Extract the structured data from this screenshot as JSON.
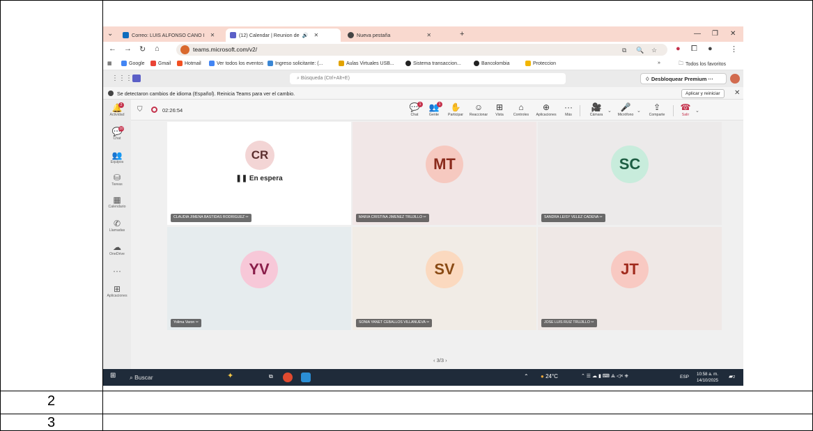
{
  "row_numbers": [
    "2",
    "3"
  ],
  "browser": {
    "tabs": [
      {
        "title": "Correo: LUIS ALFONSO CANO I",
        "fav_color": "#0f6cbd"
      },
      {
        "title": "(12) Calendar | Reunion de",
        "fav_color": "#5b5fc7",
        "audio": "🔊"
      },
      {
        "title": "Nueva pestaña",
        "fav_color": "#444444"
      }
    ],
    "new_tab": "+",
    "url": "teams.microsoft.com/v2/",
    "bookmarks": [
      {
        "label": "Google",
        "color": "#4285f4"
      },
      {
        "label": "Gmail",
        "color": "#ea4335"
      },
      {
        "label": "Hotmail",
        "color": "#f25022"
      },
      {
        "label": "Ver todos los eventos",
        "color": "#4285f4"
      },
      {
        "label": "Ingreso solicitante: (...",
        "color": "#3a86d4"
      },
      {
        "label": "Aulas Virtuales USB...",
        "color": "#e2a300"
      },
      {
        "label": "Sistema transaccion...",
        "color": "#222222"
      },
      {
        "label": "Bancolombia",
        "color": "#222222"
      },
      {
        "label": "Proteccion",
        "color": "#f2b600"
      }
    ],
    "all_favorites": "Todos los favoritos",
    "more_bookmarks": "»"
  },
  "teams": {
    "search_placeholder": "Búsqueda (Ctrl+Alt+E)",
    "premium_label": "Desbloquear Premium",
    "premium_more": "···",
    "notice_text": "Se detectaron cambios de idioma (Español). Reinicia Teams para ver el cambio.",
    "notice_button": "Aplicar y reiniciar",
    "rail": [
      {
        "label": "Actividad",
        "icon": "bell-icon",
        "glyph": "🔔",
        "badge": "2"
      },
      {
        "label": "Chat",
        "icon": "chat-icon",
        "glyph": "💬",
        "badge": "10"
      },
      {
        "label": "Equipos",
        "icon": "teams-icon",
        "glyph": "👥",
        "badge": ""
      },
      {
        "label": "Tareas",
        "icon": "tasks-icon",
        "glyph": "⛁",
        "badge": ""
      },
      {
        "label": "Calendario",
        "icon": "calendar-icon",
        "glyph": "▦",
        "badge": ""
      },
      {
        "label": "Llamadas",
        "icon": "phone-icon",
        "glyph": "✆",
        "badge": ""
      },
      {
        "label": "OneDrive",
        "icon": "cloud-icon",
        "glyph": "☁",
        "badge": ""
      },
      {
        "label": "",
        "icon": "more-icon",
        "glyph": "···",
        "badge": ""
      },
      {
        "label": "Aplicaciones",
        "icon": "apps-icon",
        "glyph": "⊞",
        "badge": ""
      }
    ],
    "meeting_timer": "02:26:54",
    "controls": [
      {
        "label": "Chat",
        "glyph": "💬",
        "badge": "1"
      },
      {
        "label": "Gente",
        "glyph": "👥",
        "badge": "1"
      },
      {
        "label": "Participar",
        "glyph": "✋",
        "badge": ""
      },
      {
        "label": "Reaccionar",
        "glyph": "☺",
        "badge": ""
      },
      {
        "label": "Vista",
        "glyph": "⊞",
        "badge": ""
      },
      {
        "label": "Controles",
        "glyph": "⌂",
        "badge": ""
      },
      {
        "label": "Aplicaciones",
        "glyph": "⊕",
        "badge": ""
      },
      {
        "label": "Más",
        "glyph": "···",
        "badge": ""
      },
      {
        "label": "Cámara",
        "glyph": "🎥",
        "badge": ""
      },
      {
        "label": "Micrófono",
        "glyph": "🎤",
        "badge": ""
      },
      {
        "label": "Comparte",
        "glyph": "⇪",
        "badge": ""
      },
      {
        "label": "Salir",
        "glyph": "☎",
        "badge": ""
      }
    ],
    "participants": [
      {
        "initials": "CR",
        "name": "CLAUDIA JIMENA BASTIDAS RODRIGUEZ",
        "status": "❚❚ En espera",
        "bg": "#ffffff",
        "circle": "#f3d5d5",
        "text": "#5c2e2e"
      },
      {
        "initials": "MT",
        "name": "MARIA CRISTINA JIMENEZ TRUJILLO",
        "status": "",
        "bg": "#f1e7e7",
        "circle": "#f6c9c0",
        "text": "#8a2a1c"
      },
      {
        "initials": "SC",
        "name": "SANDRA LEISY VELEZ CADENA",
        "status": "",
        "bg": "#eceaea",
        "circle": "#c8ecdc",
        "text": "#1d5e43"
      },
      {
        "initials": "YV",
        "name": "Yolima Varon",
        "status": "",
        "bg": "#e6ecee",
        "circle": "#f7c8d8",
        "text": "#8a1e4a"
      },
      {
        "initials": "SV",
        "name": "SONIA YANET CEBALLOS VILLANUEVA",
        "status": "",
        "bg": "#f1ece6",
        "circle": "#fbd9bf",
        "text": "#8a4a14"
      },
      {
        "initials": "JT",
        "name": "JOSE LUIS RUIZ TRUJILLO",
        "status": "",
        "bg": "#efe8e6",
        "circle": "#f8c9c2",
        "text": "#a0291c"
      }
    ],
    "pager": "‹ 3/3 ›"
  },
  "taskbar": {
    "search_label": "Buscar",
    "weather": "24°C",
    "language": "ESP",
    "time": "10:58 a. m.",
    "date": "14/10/2025",
    "notification_count": "2"
  }
}
